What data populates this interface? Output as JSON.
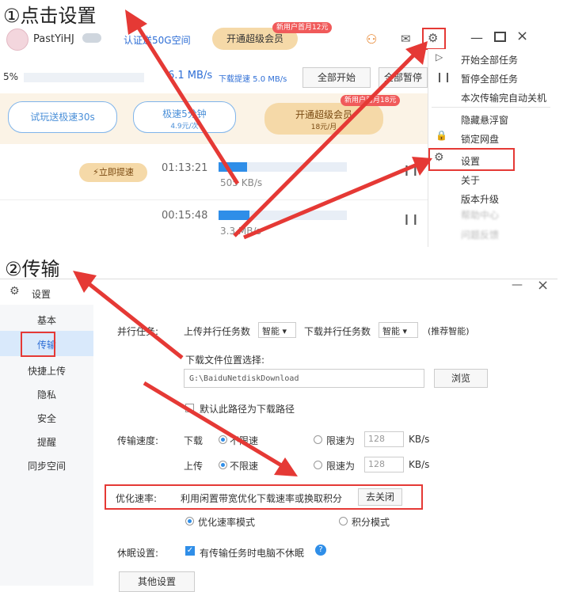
{
  "step1": {
    "title": "①点击设置"
  },
  "step2": {
    "title": "②传输"
  },
  "top": {
    "username": "PastYiHJ",
    "gift_text": "认证送50G空间",
    "vip_button": "开通超级会员",
    "promo_badge": "新用户首月12元",
    "speed_pct": "5%",
    "speed_value": "6.1 MB/s",
    "speed_boost": "下载提速 5.0 MB/s",
    "start_all": "全部开始",
    "pause_all": "全部暂停",
    "trial_button": "试玩送极速30s",
    "boost_min_button": "极速5分钟",
    "boost_min_sub": "4.9元/次",
    "vip_big_button": "开通超级会员",
    "vip_big_sub": "18元/月",
    "vip_big_badge": "新用户首月18元",
    "instant_boost": "立即提速",
    "row1": {
      "time": "01:13:21",
      "speed": "505 KB/s",
      "progress": 0.22
    },
    "row2": {
      "time": "00:15:48",
      "speed": "3.3 MB/s",
      "progress": 0.24
    }
  },
  "menu": {
    "start_all": "开始全部任务",
    "pause_all": "暂停全部任务",
    "shutdown": "本次传输完自动关机",
    "hide_float": "隐藏悬浮窗",
    "lock_disk": "锁定网盘",
    "settings": "设置",
    "about": "关于",
    "upgrade": "版本升级",
    "blur1": "帮助中心",
    "blur2": "问题反馈"
  },
  "settings": {
    "window_title": "设置",
    "nav": [
      "基本",
      "传输",
      "快捷上传",
      "隐私",
      "安全",
      "提醒",
      "同步空间"
    ],
    "parallel_label": "并行任务:",
    "upload_parallel_label": "上传并行任务数",
    "upload_parallel_value": "智能",
    "download_parallel_label": "下载并行任务数",
    "download_parallel_value": "智能",
    "recommend": "(推荐智能)",
    "download_location_label": "下载文件位置选择:",
    "download_path": "G:\\BaiduNetdiskDownload",
    "browse": "浏览",
    "default_path": "默认此路径为下载路径",
    "speed_label": "传输速度:",
    "download_label": "下载",
    "upload_label": "上传",
    "unlimited": "不限速",
    "limit_to": "限速为",
    "limit_value": "128",
    "unit": "KB/s",
    "optimize_label": "优化速率:",
    "optimize_text": "利用闲置带宽优化下载速率或换取积分",
    "optimize_button": "去关闭",
    "optimize_mode": "优化速率模式",
    "points_mode": "积分模式",
    "sleep_label": "休眠设置:",
    "sleep_text": "有传输任务时电脑不休眠",
    "other_settings": "其他设置"
  },
  "colors": {
    "accent": "#2f8ee8",
    "annotation": "#e53935",
    "vip": "#f5d9a8"
  }
}
